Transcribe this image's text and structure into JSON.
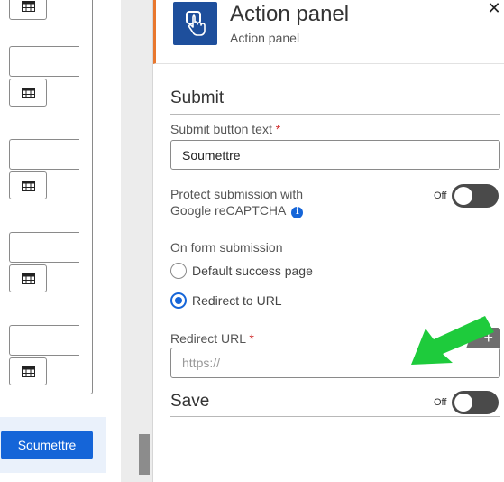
{
  "left_form": {
    "submit_button_label": "Soumettre"
  },
  "panel": {
    "title": "Action panel",
    "subtitle": "Action panel",
    "close_symbol": "✕",
    "submit_section": {
      "title": "Submit",
      "button_text_label": "Submit button text",
      "required_mark": "*",
      "button_text_value": "Soumettre",
      "recaptcha_label_line1": "Protect submission with",
      "recaptcha_label_line2": "Google reCAPTCHA",
      "recaptcha_toggle_label": "Off",
      "recaptcha_enabled": false,
      "on_submission_label": "On form submission",
      "options": [
        {
          "label": "Default success page",
          "checked": false
        },
        {
          "label": "Redirect to URL",
          "checked": true
        }
      ],
      "redirect_url_label": "Redirect URL",
      "redirect_url_placeholder": "https://",
      "redirect_url_value": "",
      "add_symbol": "+"
    },
    "save_section": {
      "title": "Save",
      "toggle_label": "Off",
      "enabled": false
    }
  },
  "colors": {
    "accent_blue": "#1565d8",
    "header_icon_bg": "#1e4f9c",
    "header_accent": "#e8772e",
    "annotation_arrow": "#1ecb3c",
    "required": "#d12d2d"
  },
  "icons": [
    "table-icon",
    "touch-hand-icon",
    "close-icon",
    "info-icon",
    "plus-icon",
    "arrow-annotation-icon"
  ]
}
